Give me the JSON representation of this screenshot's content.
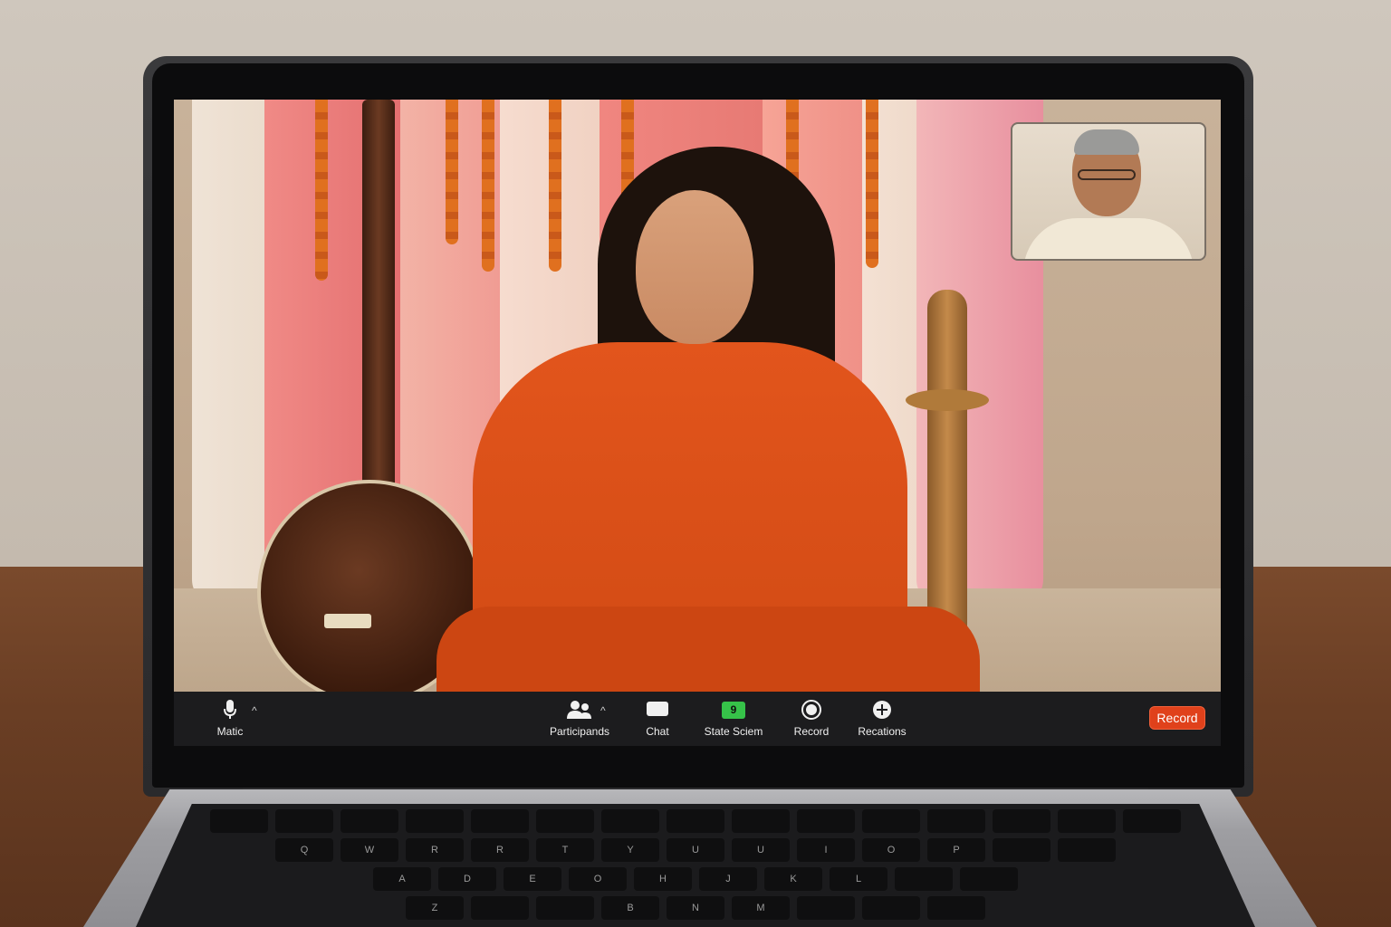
{
  "meeting": {
    "controls": {
      "mute": {
        "label": "Matic",
        "icon": "microphone-icon"
      },
      "participants": {
        "label": "Participands",
        "icon": "participants-icon"
      },
      "chat": {
        "label": "Chat",
        "icon": "chat-icon"
      },
      "share": {
        "label": "State Sciem",
        "icon": "share-screen-icon",
        "badge": "9",
        "badge_color": "#36c249"
      },
      "record": {
        "label": "Record",
        "icon": "record-icon"
      },
      "reactions": {
        "label": "Recations",
        "icon": "reactions-icon"
      }
    },
    "record_button": {
      "label": "Record",
      "color": "#e0411b"
    },
    "bar_color": "#1c1c1e"
  },
  "keyboard": {
    "row1": [
      "",
      "",
      "",
      "",
      "",
      "",
      "",
      "",
      "",
      "",
      "",
      "",
      "",
      "",
      ""
    ],
    "row2": [
      "Q",
      "W",
      "R",
      "R",
      "T",
      "Y",
      "U",
      "U",
      "I",
      "O",
      "P",
      "",
      ""
    ],
    "row3": [
      "A",
      "D",
      "E",
      "O",
      "H",
      "J",
      "K",
      "L",
      "",
      ""
    ],
    "row4": [
      "Z",
      "",
      "",
      "B",
      "N",
      "M",
      "",
      "",
      ""
    ]
  }
}
